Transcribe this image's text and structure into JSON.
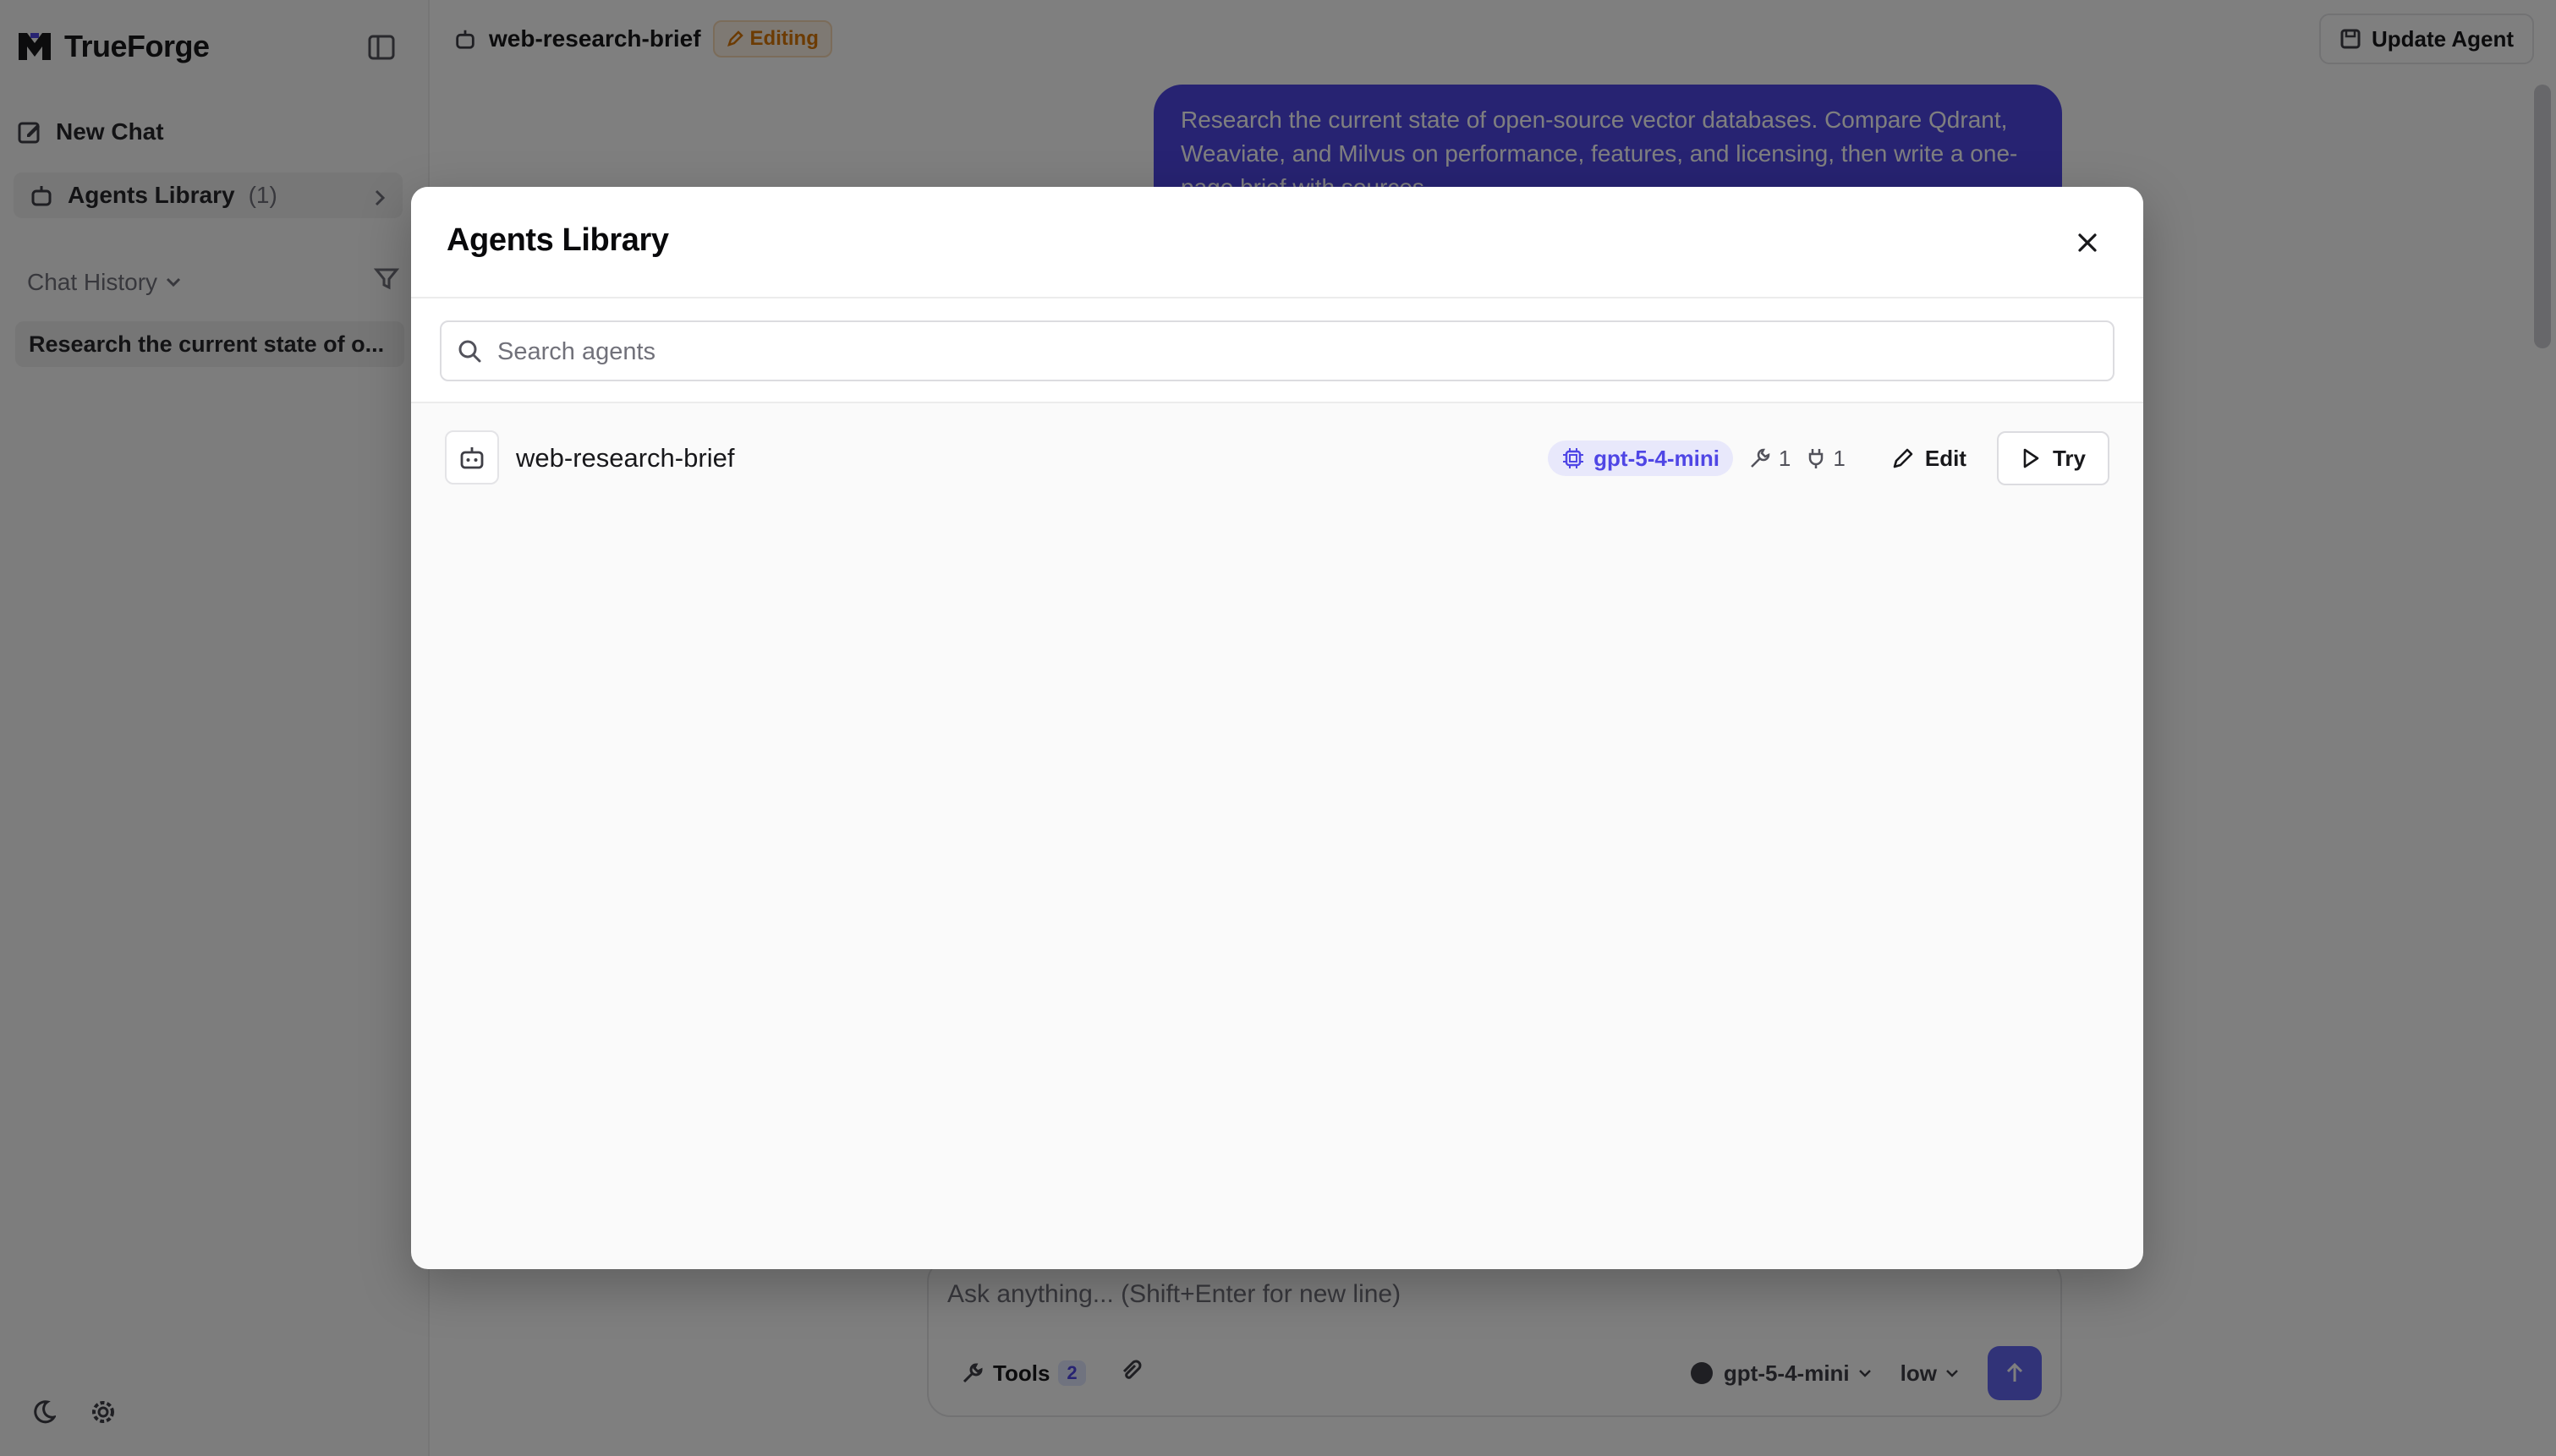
{
  "sidebar": {
    "brand": "TrueForge",
    "new_chat": "New Chat",
    "agents_library": "Agents Library",
    "agents_count": "(1)",
    "chat_history": "Chat History",
    "history_items": [
      "Research the current state of o..."
    ]
  },
  "header": {
    "agent_name": "web-research-brief",
    "editing_badge": "Editing",
    "update_button": "Update Agent"
  },
  "chat": {
    "user_message": "Research the current state of open-source vector databases. Compare Qdrant, Weaviate, and Milvus on performance, features, and licensing, then write a one-page brief with sources.",
    "composer_placeholder": "Ask anything... (Shift+Enter for new line)",
    "tools_label": "Tools",
    "tools_count": "2",
    "model": "gpt-5-4-mini",
    "effort": "low"
  },
  "modal": {
    "title": "Agents Library",
    "search_placeholder": "Search agents",
    "agents": [
      {
        "name": "web-research-brief",
        "model": "gpt-5-4-mini",
        "tools_count": "1",
        "plugins_count": "1",
        "edit_label": "Edit",
        "try_label": "Try"
      }
    ]
  },
  "colors": {
    "accent": "#4f46e5",
    "badge_bg": "#e8e8fb",
    "editing": "#d97706"
  }
}
